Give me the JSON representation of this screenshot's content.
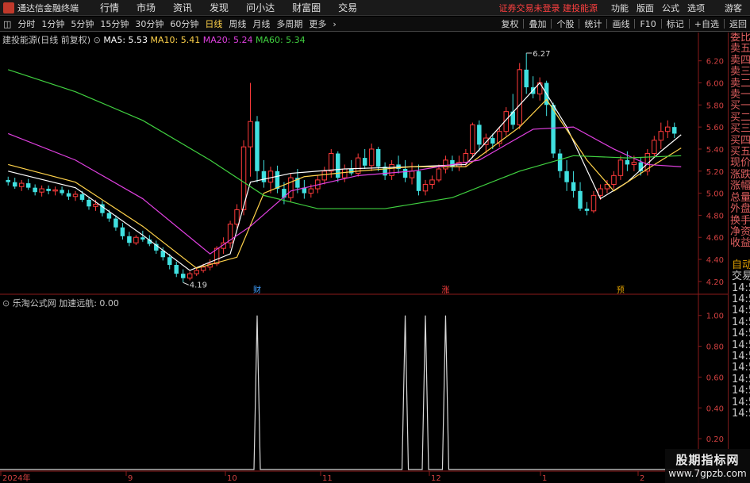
{
  "menubar": {
    "app_name": "通达信金融终端",
    "menus": [
      "行情",
      "市场",
      "资讯",
      "发现",
      "问小达",
      "财富圈",
      "交易"
    ],
    "login_warning": "证券交易未登录  建投能源",
    "right_menus": [
      "功能",
      "版面",
      "公式",
      "选项"
    ],
    "guest": "游客"
  },
  "toolbar": {
    "periods": [
      "分时",
      "1分钟",
      "5分钟",
      "15分钟",
      "30分钟",
      "60分钟",
      "日线",
      "周线",
      "月线",
      "多周期",
      "更多"
    ],
    "active_period": "日线",
    "right_buttons": [
      "复权",
      "叠加",
      "个股",
      "统计",
      "画线",
      "F10",
      "标记",
      "+自选",
      "返回"
    ]
  },
  "main_chart": {
    "title": "建投能源(日线 前复权)",
    "ma": [
      {
        "label": "MA5: 5.53",
        "color": "#ffffff"
      },
      {
        "label": "MA10: 5.41",
        "color": "#ffd24a"
      },
      {
        "label": "MA20: 5.24",
        "color": "#e040e0"
      },
      {
        "label": "MA60: 5.34",
        "color": "#40d040"
      }
    ],
    "y_ticks": [
      "6.20",
      "6.00",
      "5.80",
      "5.60",
      "5.40",
      "5.20",
      "5.00",
      "4.80",
      "4.60",
      "4.40",
      "4.20"
    ],
    "high_label": "6.27",
    "low_label": "4.19",
    "markers": [
      {
        "text": "财",
        "color": "#40a0ff"
      },
      {
        "text": "涨",
        "color": "#ff4040"
      },
      {
        "text": "预",
        "color": "#e0a000"
      }
    ]
  },
  "sub_chart": {
    "title": "乐淘公式网",
    "indicator": "加速远航: 0.00",
    "y_ticks": [
      "1.00",
      "0.80",
      "0.60",
      "0.40",
      "0.20"
    ]
  },
  "x_axis": [
    "2024年",
    "9",
    "10",
    "11",
    "12",
    "1",
    "2"
  ],
  "side_panel": {
    "top_labels": [
      "委比",
      "卖五",
      "卖四",
      "卖三",
      "卖二",
      "卖一",
      "买一",
      "买二",
      "买三",
      "买四",
      "买五",
      "现价",
      "涨跌",
      "涨幅",
      "总量",
      "外盘",
      "换手",
      "净资",
      "收益"
    ],
    "bottom_top": [
      "自动",
      "交易"
    ],
    "times": [
      "14:56",
      "14:56",
      "14:56",
      "14:56",
      "14:56",
      "14:56",
      "14:56",
      "14:56",
      "14:56",
      "14:56",
      "14:56",
      "14:56"
    ]
  },
  "watermark": {
    "line1": "股期指标网",
    "line2": "www.7gpzb.com"
  },
  "chart_data": {
    "type": "candlestick",
    "price_range": [
      4.12,
      6.32
    ],
    "candles_ohlc": [
      [
        5.12,
        5.15,
        5.07,
        5.1
      ],
      [
        5.1,
        5.14,
        5.04,
        5.06
      ],
      [
        5.06,
        5.12,
        5.02,
        5.09
      ],
      [
        5.09,
        5.13,
        5.03,
        5.05
      ],
      [
        5.05,
        5.08,
        4.98,
        5.01
      ],
      [
        5.01,
        5.07,
        4.97,
        5.04
      ],
      [
        5.04,
        5.07,
        4.99,
        5.02
      ],
      [
        5.02,
        5.06,
        4.98,
        5.03
      ],
      [
        5.03,
        5.06,
        4.98,
        5.0
      ],
      [
        5.0,
        5.03,
        4.94,
        4.97
      ],
      [
        4.97,
        5.02,
        4.93,
        4.99
      ],
      [
        4.99,
        5.02,
        4.92,
        4.94
      ],
      [
        4.94,
        4.96,
        4.85,
        4.88
      ],
      [
        4.88,
        4.94,
        4.84,
        4.9
      ],
      [
        4.9,
        4.93,
        4.79,
        4.82
      ],
      [
        4.82,
        4.85,
        4.74,
        4.77
      ],
      [
        4.77,
        4.8,
        4.66,
        4.69
      ],
      [
        4.69,
        4.73,
        4.58,
        4.61
      ],
      [
        4.61,
        4.65,
        4.52,
        4.55
      ],
      [
        4.55,
        4.62,
        4.53,
        4.6
      ],
      [
        4.6,
        4.66,
        4.56,
        4.58
      ],
      [
        4.58,
        4.62,
        4.52,
        4.54
      ],
      [
        4.54,
        4.57,
        4.45,
        4.48
      ],
      [
        4.48,
        4.51,
        4.39,
        4.42
      ],
      [
        4.42,
        4.45,
        4.31,
        4.35
      ],
      [
        4.35,
        4.38,
        4.24,
        4.27
      ],
      [
        4.27,
        4.31,
        4.19,
        4.23
      ],
      [
        4.23,
        4.29,
        4.21,
        4.27
      ],
      [
        4.27,
        4.33,
        4.25,
        4.3
      ],
      [
        4.3,
        4.36,
        4.28,
        4.33
      ],
      [
        4.33,
        4.4,
        4.3,
        4.36
      ],
      [
        4.36,
        4.52,
        4.34,
        4.5
      ],
      [
        4.5,
        4.6,
        4.45,
        4.55
      ],
      [
        4.55,
        4.75,
        4.5,
        4.72
      ],
      [
        4.72,
        4.9,
        4.68,
        4.85
      ],
      [
        4.85,
        5.48,
        4.8,
        5.42
      ],
      [
        5.42,
        6.0,
        5.15,
        5.65
      ],
      [
        5.65,
        5.7,
        5.1,
        5.2
      ],
      [
        5.2,
        5.3,
        5.05,
        5.1
      ],
      [
        5.1,
        5.24,
        5.0,
        5.2
      ],
      [
        5.2,
        5.25,
        5.0,
        5.04
      ],
      [
        5.04,
        5.1,
        4.9,
        4.96
      ],
      [
        4.96,
        5.18,
        4.92,
        5.14
      ],
      [
        5.14,
        5.22,
        5.0,
        5.05
      ],
      [
        5.05,
        5.12,
        4.95,
        5.0
      ],
      [
        5.0,
        5.08,
        4.96,
        5.04
      ],
      [
        5.04,
        5.16,
        5.0,
        5.12
      ],
      [
        5.12,
        5.24,
        5.08,
        5.2
      ],
      [
        5.2,
        5.4,
        5.14,
        5.36
      ],
      [
        5.36,
        5.38,
        5.1,
        5.14
      ],
      [
        5.14,
        5.26,
        5.1,
        5.22
      ],
      [
        5.22,
        5.3,
        5.16,
        5.18
      ],
      [
        5.18,
        5.36,
        5.15,
        5.32
      ],
      [
        5.32,
        5.4,
        5.22,
        5.25
      ],
      [
        5.25,
        5.45,
        5.2,
        5.4
      ],
      [
        5.4,
        5.42,
        5.2,
        5.24
      ],
      [
        5.24,
        5.28,
        5.12,
        5.16
      ],
      [
        5.16,
        5.3,
        5.12,
        5.26
      ],
      [
        5.26,
        5.34,
        5.18,
        5.22
      ],
      [
        5.22,
        5.3,
        5.1,
        5.14
      ],
      [
        5.14,
        5.28,
        5.08,
        5.2
      ],
      [
        5.2,
        5.26,
        4.98,
        5.02
      ],
      [
        5.02,
        5.12,
        4.98,
        5.08
      ],
      [
        5.08,
        5.16,
        5.04,
        5.12
      ],
      [
        5.12,
        5.26,
        5.1,
        5.22
      ],
      [
        5.22,
        5.34,
        5.18,
        5.3
      ],
      [
        5.3,
        5.34,
        5.2,
        5.24
      ],
      [
        5.24,
        5.34,
        5.2,
        5.28
      ],
      [
        5.28,
        5.4,
        5.24,
        5.36
      ],
      [
        5.36,
        5.64,
        5.32,
        5.62
      ],
      [
        5.62,
        5.66,
        5.38,
        5.44
      ],
      [
        5.44,
        5.54,
        5.36,
        5.5
      ],
      [
        5.5,
        5.54,
        5.4,
        5.45
      ],
      [
        5.45,
        5.6,
        5.42,
        5.56
      ],
      [
        5.56,
        5.78,
        5.52,
        5.74
      ],
      [
        5.74,
        5.9,
        5.58,
        5.62
      ],
      [
        5.62,
        6.18,
        5.58,
        6.12
      ],
      [
        6.12,
        6.27,
        5.9,
        5.96
      ],
      [
        5.96,
        6.06,
        5.86,
        5.9
      ],
      [
        5.9,
        6.05,
        5.84,
        6.0
      ],
      [
        6.0,
        6.02,
        5.7,
        5.8
      ],
      [
        5.8,
        5.82,
        5.32,
        5.36
      ],
      [
        5.36,
        5.4,
        5.14,
        5.2
      ],
      [
        5.2,
        5.3,
        5.02,
        5.1
      ],
      [
        5.1,
        5.2,
        4.96,
        5.02
      ],
      [
        5.02,
        5.1,
        4.84,
        4.86
      ],
      [
        4.86,
        4.92,
        4.8,
        4.84
      ],
      [
        4.84,
        5.02,
        4.82,
        4.98
      ],
      [
        4.98,
        5.08,
        4.94,
        5.04
      ],
      [
        5.04,
        5.12,
        5.0,
        5.08
      ],
      [
        5.08,
        5.2,
        5.04,
        5.16
      ],
      [
        5.16,
        5.34,
        5.12,
        5.3
      ],
      [
        5.3,
        5.38,
        5.2,
        5.26
      ],
      [
        5.26,
        5.34,
        5.2,
        5.28
      ],
      [
        5.28,
        5.32,
        5.16,
        5.2
      ],
      [
        5.2,
        5.4,
        5.16,
        5.36
      ],
      [
        5.36,
        5.52,
        5.32,
        5.48
      ],
      [
        5.48,
        5.64,
        5.4,
        5.56
      ],
      [
        5.56,
        5.66,
        5.5,
        5.6
      ],
      [
        5.6,
        5.64,
        5.5,
        5.54
      ]
    ],
    "ma_series": {
      "ma5": [
        [
          0,
          5.2
        ],
        [
          10,
          5.05
        ],
        [
          20,
          4.62
        ],
        [
          27,
          4.3
        ],
        [
          33,
          4.45
        ],
        [
          36,
          5.1
        ],
        [
          42,
          5.18
        ],
        [
          50,
          5.22
        ],
        [
          60,
          5.24
        ],
        [
          68,
          5.26
        ],
        [
          76,
          5.8
        ],
        [
          79,
          6.0
        ],
        [
          83,
          5.6
        ],
        [
          88,
          4.95
        ],
        [
          92,
          5.1
        ],
        [
          97,
          5.38
        ],
        [
          100,
          5.53
        ]
      ],
      "ma10": [
        [
          0,
          5.26
        ],
        [
          10,
          5.1
        ],
        [
          20,
          4.7
        ],
        [
          28,
          4.32
        ],
        [
          34,
          4.42
        ],
        [
          38,
          5.0
        ],
        [
          44,
          5.15
        ],
        [
          52,
          5.2
        ],
        [
          60,
          5.24
        ],
        [
          68,
          5.24
        ],
        [
          76,
          5.6
        ],
        [
          80,
          5.85
        ],
        [
          86,
          5.3
        ],
        [
          90,
          5.02
        ],
        [
          95,
          5.22
        ],
        [
          100,
          5.41
        ]
      ],
      "ma20": [
        [
          0,
          5.54
        ],
        [
          10,
          5.3
        ],
        [
          20,
          4.95
        ],
        [
          30,
          4.45
        ],
        [
          36,
          4.7
        ],
        [
          42,
          5.02
        ],
        [
          52,
          5.16
        ],
        [
          60,
          5.2
        ],
        [
          70,
          5.3
        ],
        [
          78,
          5.58
        ],
        [
          84,
          5.6
        ],
        [
          90,
          5.4
        ],
        [
          95,
          5.26
        ],
        [
          100,
          5.24
        ]
      ],
      "ma60": [
        [
          0,
          6.12
        ],
        [
          10,
          5.92
        ],
        [
          20,
          5.66
        ],
        [
          30,
          5.3
        ],
        [
          38,
          4.98
        ],
        [
          46,
          4.86
        ],
        [
          56,
          4.86
        ],
        [
          66,
          4.96
        ],
        [
          76,
          5.2
        ],
        [
          84,
          5.34
        ],
        [
          92,
          5.32
        ],
        [
          100,
          5.34
        ]
      ]
    },
    "signal_spikes": [
      37,
      59,
      62,
      65
    ],
    "indicator_range": [
      0,
      1.05
    ]
  }
}
